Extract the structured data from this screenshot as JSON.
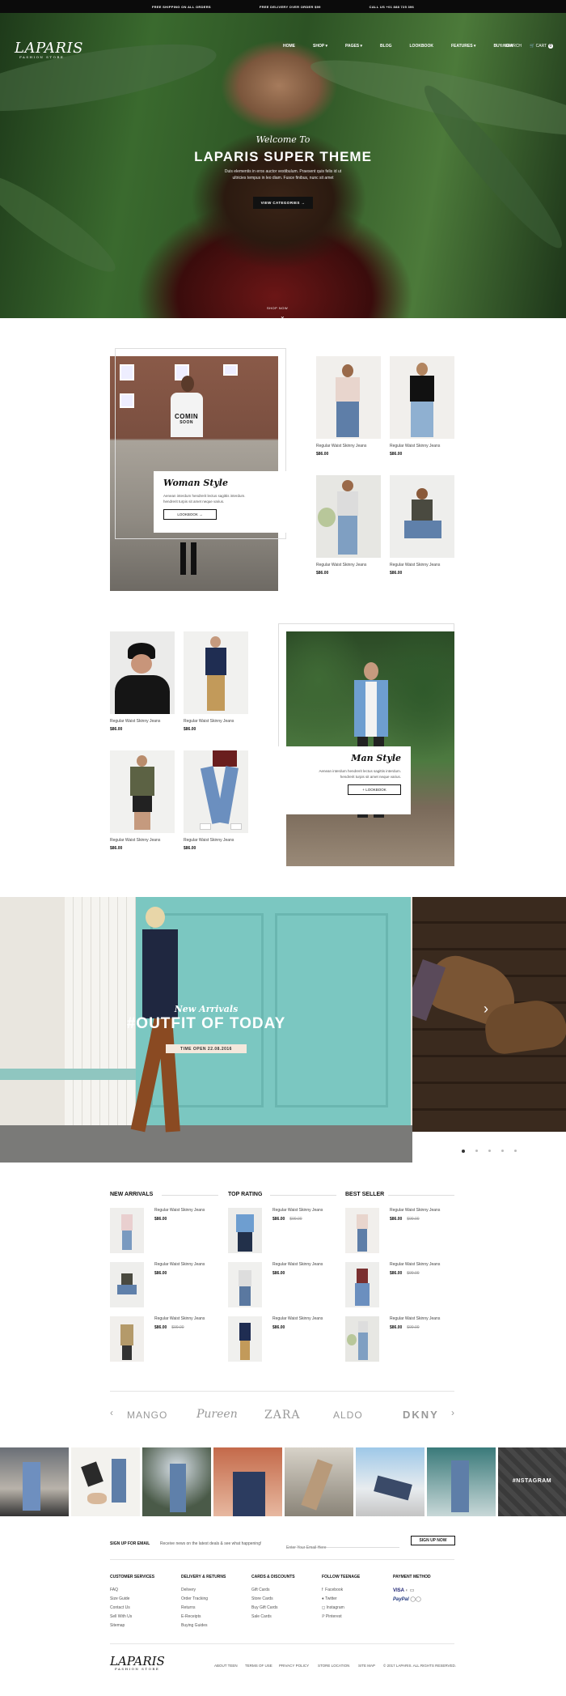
{
  "topbar": {
    "msg1": "FREE SHIPPING ON ALL ORDERS",
    "msg2": "FREE DELIVERY OVER ORDER $99",
    "msg3": "CALL US +01 888 725 396"
  },
  "nav": {
    "logo": "LAPARIS",
    "logo_sub": "FASHION STORE",
    "items": [
      "HOME",
      "SHOP",
      "PAGES",
      "BLOG",
      "LOOKBOOK",
      "FEATURES",
      "BUY NOW"
    ],
    "search": "SEARCH",
    "cart": "CART",
    "cart_count": "0"
  },
  "hero": {
    "subtitle": "Welcome To",
    "title": "LAPARIS SUPER THEME",
    "desc1": "Duis elementis in eros auctor vestibulum. Praesent quis felis id ut",
    "desc2": "ultricies tempus in leo diam. Fusce finibus, nunc sit amet",
    "button": "VIEW CATEGORIES",
    "shop": "SHOP NOW"
  },
  "woman": {
    "title": "Woman Style",
    "desc1": "Aenean interdum hendrerit lectus sagittis interdum.",
    "desc2": "hendrerit turpis sit amet neque varius.",
    "button": "LOOKBOOK",
    "shirt1": "COMIN",
    "shirt2": "SOON"
  },
  "man": {
    "title": "Man Style",
    "desc1": "Aenean interdum hendrerit lectus sagittis interdum.",
    "desc2": "hendrerit turpis sit amet neque varius.",
    "button": "LOOKBOOK"
  },
  "product": {
    "name": "Regular Waist Skinny Jeans",
    "price": "$86.00",
    "old_price": "$99.00"
  },
  "banner": {
    "sub": "New Arrivals",
    "title": "#OUTFIT OF TODAY",
    "tag": "TIME OPEN 22.08.2016"
  },
  "lists": {
    "new": "NEW ARRIVALS",
    "top": "TOP RATING",
    "best": "BEST SELLER"
  },
  "brands": [
    "MANGO",
    "Pureen",
    "ZARA",
    "ALDO",
    "DKNY"
  ],
  "instagram": {
    "label": "#NSTAGRAM"
  },
  "newsletter": {
    "title": "SIGN UP FOR EMAIL",
    "desc": "Receive news on the latest deals & see what happening!",
    "placeholder": "Enter Your Email Here",
    "button": "SIGN UP NOW"
  },
  "footer": {
    "cols": [
      {
        "title": "CUSTOMER SERVICES",
        "links": [
          "FAQ",
          "Size Guide",
          "Contact Us",
          "Sell With Us",
          "Sitemap"
        ]
      },
      {
        "title": "DELIVERY & RETURNS",
        "links": [
          "Delivery",
          "Order Tracking",
          "Returns",
          "E-Receipts",
          "Buying Guides"
        ]
      },
      {
        "title": "CARDS & DISCOUNTS",
        "links": [
          "Gift Cards",
          "Store Cards",
          "Buy Gift Cards",
          "Sale Cards"
        ]
      },
      {
        "title": "FOLLOW TEENAGE",
        "links": [
          "Facebook",
          "Twitter",
          "Instagram",
          "Pinterest"
        ]
      },
      {
        "title": "PAYMENT METHOD",
        "links": [
          "VISA",
          "PayPal"
        ]
      }
    ],
    "bottom": [
      "ABOUT TEEN",
      "TERMS OF USE",
      "PRIVACY POLICY",
      "STORE LOCATION",
      "SITE MAP",
      "© 2017 LAPARIS. ALL RIGHTS RESERVED."
    ]
  }
}
